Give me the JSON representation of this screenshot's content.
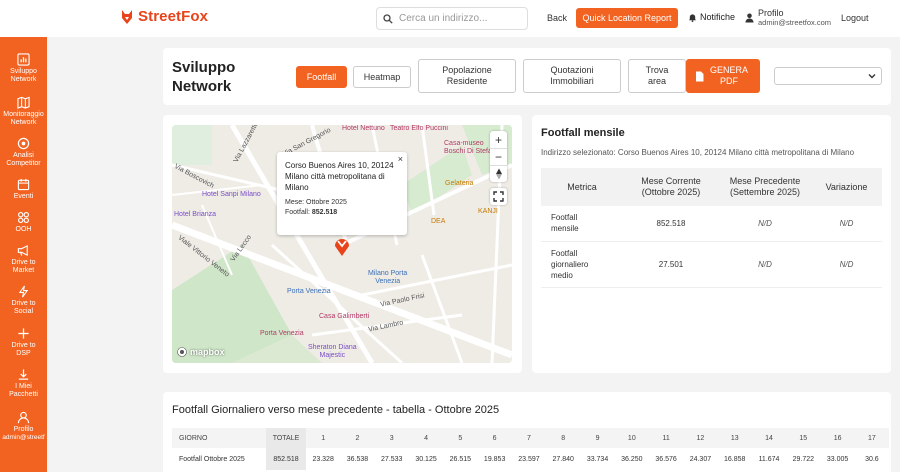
{
  "brand": {
    "name": "StreetFox",
    "color": "#f26322"
  },
  "header": {
    "search_placeholder": "Cerca un indirizzo...",
    "back_label": "Back",
    "quick_report_label": "Quick Location Report",
    "notifications_label": "Notifiche",
    "profile_label": "Profilo",
    "profile_email": "admin@streetfox.com",
    "logout_label": "Logout"
  },
  "sidebar": {
    "items": [
      {
        "label_l1": "Sviluppo",
        "label_l2": "Network",
        "icon": "bar-chart-icon"
      },
      {
        "label_l1": "Monitoraggio",
        "label_l2": "Network",
        "icon": "map-icon"
      },
      {
        "label_l1": "Analisi",
        "label_l2": "Competitor",
        "icon": "target-icon"
      },
      {
        "label_l1": "Eventi",
        "label_l2": "",
        "icon": "calendar-icon"
      },
      {
        "label_l1": "OOH",
        "label_l2": "",
        "icon": "grid-icon"
      },
      {
        "label_l1": "Drive to",
        "label_l2": "Market",
        "icon": "megaphone-icon"
      },
      {
        "label_l1": "Drive to",
        "label_l2": "Social",
        "icon": "bolt-icon"
      },
      {
        "label_l1": "Drive to",
        "label_l2": "DSP",
        "icon": "plus-icon"
      },
      {
        "label_l1": "I Miei",
        "label_l2": "Pacchetti",
        "icon": "download-icon"
      },
      {
        "label_l1": "Profilo",
        "label_l2": "admin@streetf",
        "icon": "user-icon"
      }
    ]
  },
  "page": {
    "title_l1": "Sviluppo",
    "title_l2": "Network",
    "tabs": {
      "footfall": "Footfall",
      "heatmap": "Heatmap",
      "popolazione_l1": "Popolazione",
      "popolazione_l2": "Residente",
      "quotazioni_l1": "Quotazioni",
      "quotazioni_l2": "Immobiliari",
      "trova_l1": "Trova",
      "trova_l2": "area",
      "genera_l1": "GENERA",
      "genera_l2": "PDF"
    }
  },
  "map": {
    "popup": {
      "address": "Corso Buenos Aires 10, 20124 Milano città metropolitana di Milano",
      "month_label": "Mese:",
      "month_value": "Ottobre 2025",
      "footfall_label": "Footfall:",
      "footfall_value": "852.518"
    },
    "attribution": "mapbox",
    "labels": {
      "hotel_nettuno": "Hotel Nettuno",
      "teatro": "Teatro Elfo Puccini",
      "casa_museo_l1": "Casa-museo",
      "casa_museo_l2": "Boschi Di Stefano",
      "via_lazzaretto": "Via Lazzaretto",
      "via_san_gregorio": "Via San Gregorio",
      "via_boscovich": "Via Boscovich",
      "hotel_sanpi": "Hotel Sanpi Milano",
      "hotel_brianza": "Hotel Brianza",
      "viale_vittorio": "Viale Vittorio Veneto",
      "via_lecco": "Via Lecco",
      "milano_porta_l1": "Milano Porta",
      "milano_porta_l2": "Venezia",
      "porta_venezia": "Porta Venezia",
      "via_paolo_frisi": "Via Paolo Frisi",
      "casa_galimberti": "Casa Galimberti",
      "via_lambro": "Via Lambro",
      "porta_venezia_2": "Porta Venezia",
      "sheraton_l1": "Sheraton Diana",
      "sheraton_l2": "Majestic",
      "kanji": "KANJI",
      "dea": "DEA",
      "gelateria": "Gelateria"
    }
  },
  "footfall_card": {
    "title": "Footfall mensile",
    "subtitle": "Indirizzo selezionato: Corso Buenos Aires 10, 20124 Milano città metropolitana di Milano",
    "headers": {
      "metrica": "Metrica",
      "corrente_l1": "Mese Corrente",
      "corrente_l2": "(Ottobre 2025)",
      "precedente_l1": "Mese Precedente",
      "precedente_l2": "(Settembre 2025)",
      "variazione": "Variazione"
    },
    "rows": [
      {
        "metric_l1": "Footfall",
        "metric_l2": "mensile",
        "metric_l3": "",
        "current": "852.518",
        "previous": "N/D",
        "variation": "N/D"
      },
      {
        "metric_l1": "Footfall",
        "metric_l2": "giornaliero",
        "metric_l3": "medio",
        "current": "27.501",
        "previous": "N/D",
        "variation": "N/D"
      }
    ]
  },
  "daily": {
    "title": "Footfall Giornaliero verso mese precedente - tabella - Ottobre 2025",
    "col_giorno": "GIORNO",
    "col_totale": "TOTALE",
    "days": [
      "1",
      "2",
      "3",
      "4",
      "5",
      "6",
      "7",
      "8",
      "9",
      "10",
      "11",
      "12",
      "13",
      "14",
      "15",
      "16",
      "17"
    ],
    "row_label": "Footfall Ottobre 2025",
    "row_total": "852.518",
    "row_values": [
      "23.328",
      "36.538",
      "27.533",
      "30.125",
      "26.515",
      "19.853",
      "23.597",
      "27.840",
      "33.734",
      "36.250",
      "36.576",
      "24.307",
      "16.858",
      "11.674",
      "29.722",
      "33.005",
      "30.6"
    ]
  }
}
